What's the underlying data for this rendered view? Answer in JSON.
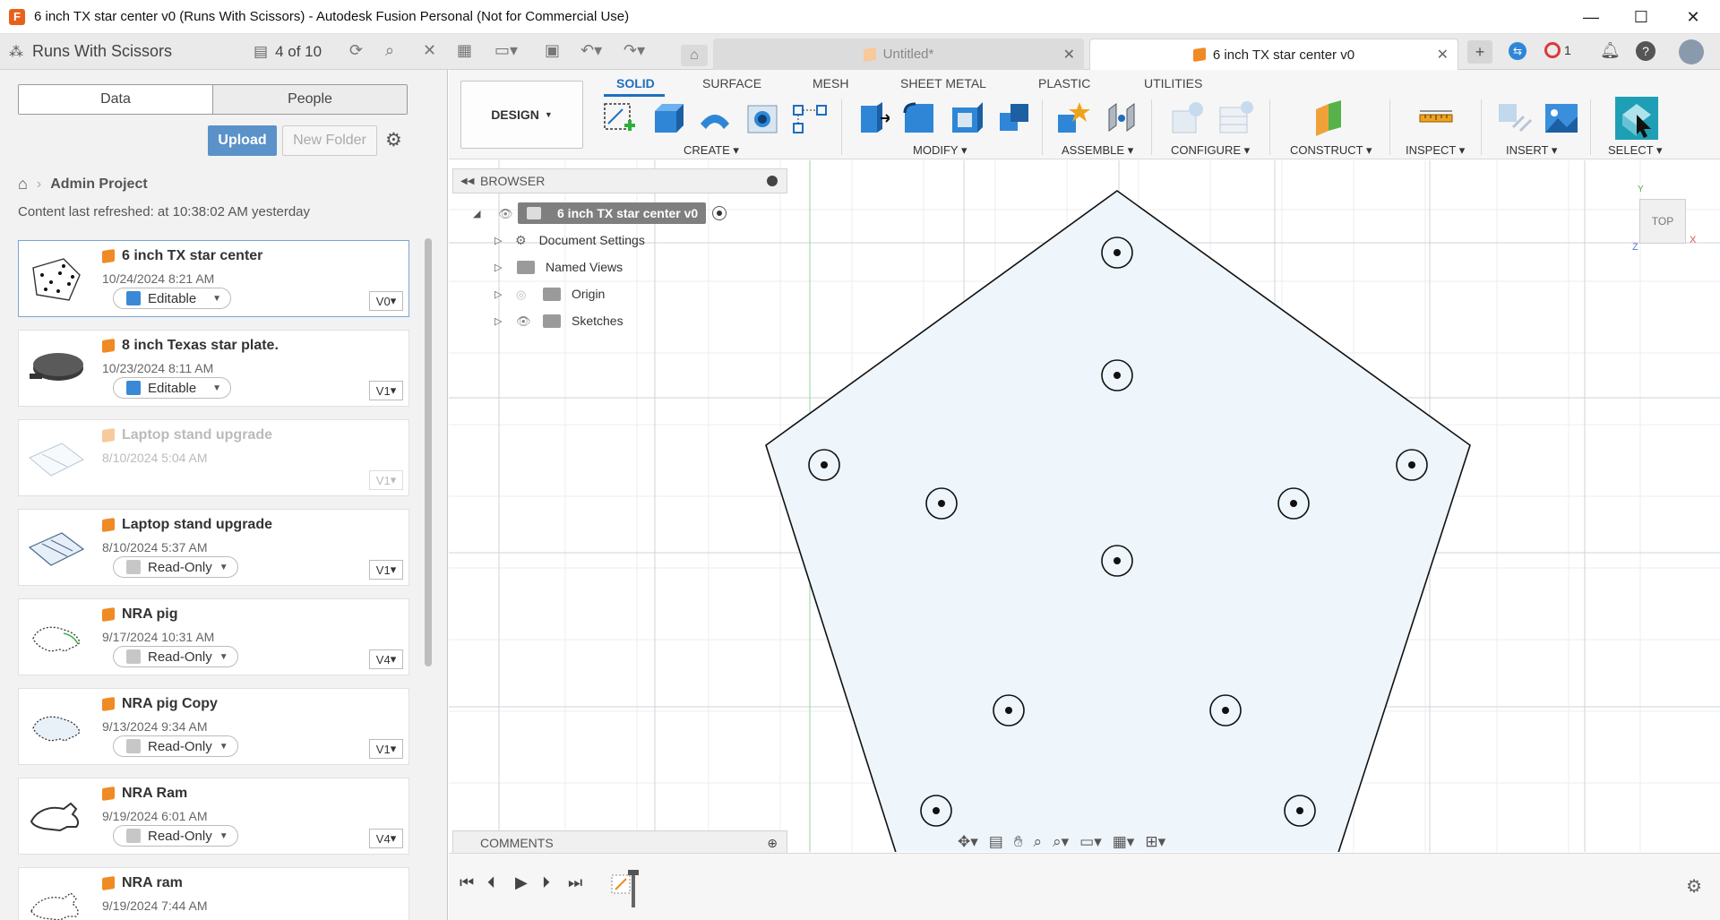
{
  "window": {
    "title": "6 inch TX star center v0 (Runs With Scissors) - Autodesk Fusion Personal (Not for Commercial Use)",
    "minimize": "—",
    "maximize": "☐",
    "close": "✕"
  },
  "apptools": {
    "team": "Runs With Scissors",
    "page_count": "4 of 10",
    "tabs": [
      {
        "label": "Untitled*"
      },
      {
        "label": "6 inch TX star center v0"
      }
    ],
    "notifications_count": "1"
  },
  "datapanel": {
    "tab_data": "Data",
    "tab_people": "People",
    "upload": "Upload",
    "new_folder": "New Folder",
    "project": "Admin Project",
    "refreshed": "Content last refreshed: at 10:38:02 AM yesterday",
    "files": [
      {
        "name": "6 inch TX star center",
        "date": "10/24/2024 8:21 AM",
        "perm": "Editable",
        "ver": "V0"
      },
      {
        "name": "8 inch Texas star plate.",
        "date": "10/23/2024 8:11 AM",
        "perm": "Editable",
        "ver": "V1"
      },
      {
        "name": "Laptop stand upgrade",
        "date": "8/10/2024 5:04 AM",
        "perm": "",
        "ver": "V1"
      },
      {
        "name": "Laptop stand upgrade",
        "date": "8/10/2024 5:37 AM",
        "perm": "Read-Only",
        "ver": "V1"
      },
      {
        "name": "NRA pig",
        "date": "9/17/2024 10:31 AM",
        "perm": "Read-Only",
        "ver": "V4"
      },
      {
        "name": "NRA pig Copy",
        "date": "9/13/2024 9:34 AM",
        "perm": "Read-Only",
        "ver": "V1"
      },
      {
        "name": "NRA Ram",
        "date": "9/19/2024 6:01 AM",
        "perm": "Read-Only",
        "ver": "V4"
      },
      {
        "name": "NRA ram",
        "date": "9/19/2024 7:44 AM",
        "perm": "",
        "ver": ""
      }
    ]
  },
  "ribbon": {
    "workspace": "DESIGN",
    "tabs": [
      "SOLID",
      "SURFACE",
      "MESH",
      "SHEET METAL",
      "PLASTIC",
      "UTILITIES"
    ],
    "groups": [
      "CREATE",
      "MODIFY",
      "ASSEMBLE",
      "CONFIGURE",
      "CONSTRUCT",
      "INSPECT",
      "INSERT",
      "SELECT"
    ]
  },
  "browser": {
    "title": "BROWSER",
    "root": "6 inch TX star center v0",
    "items": [
      "Document Settings",
      "Named Views",
      "Origin",
      "Sketches"
    ]
  },
  "comments": {
    "title": "COMMENTS"
  },
  "viewcube": {
    "face": "TOP",
    "axis_y": "Y",
    "axis_x": "X",
    "axis_z": "Z"
  },
  "colors": {
    "accent": "#1e6fbf",
    "sketch_fill": "#eef5fb",
    "part_orange": "#f08a24"
  }
}
